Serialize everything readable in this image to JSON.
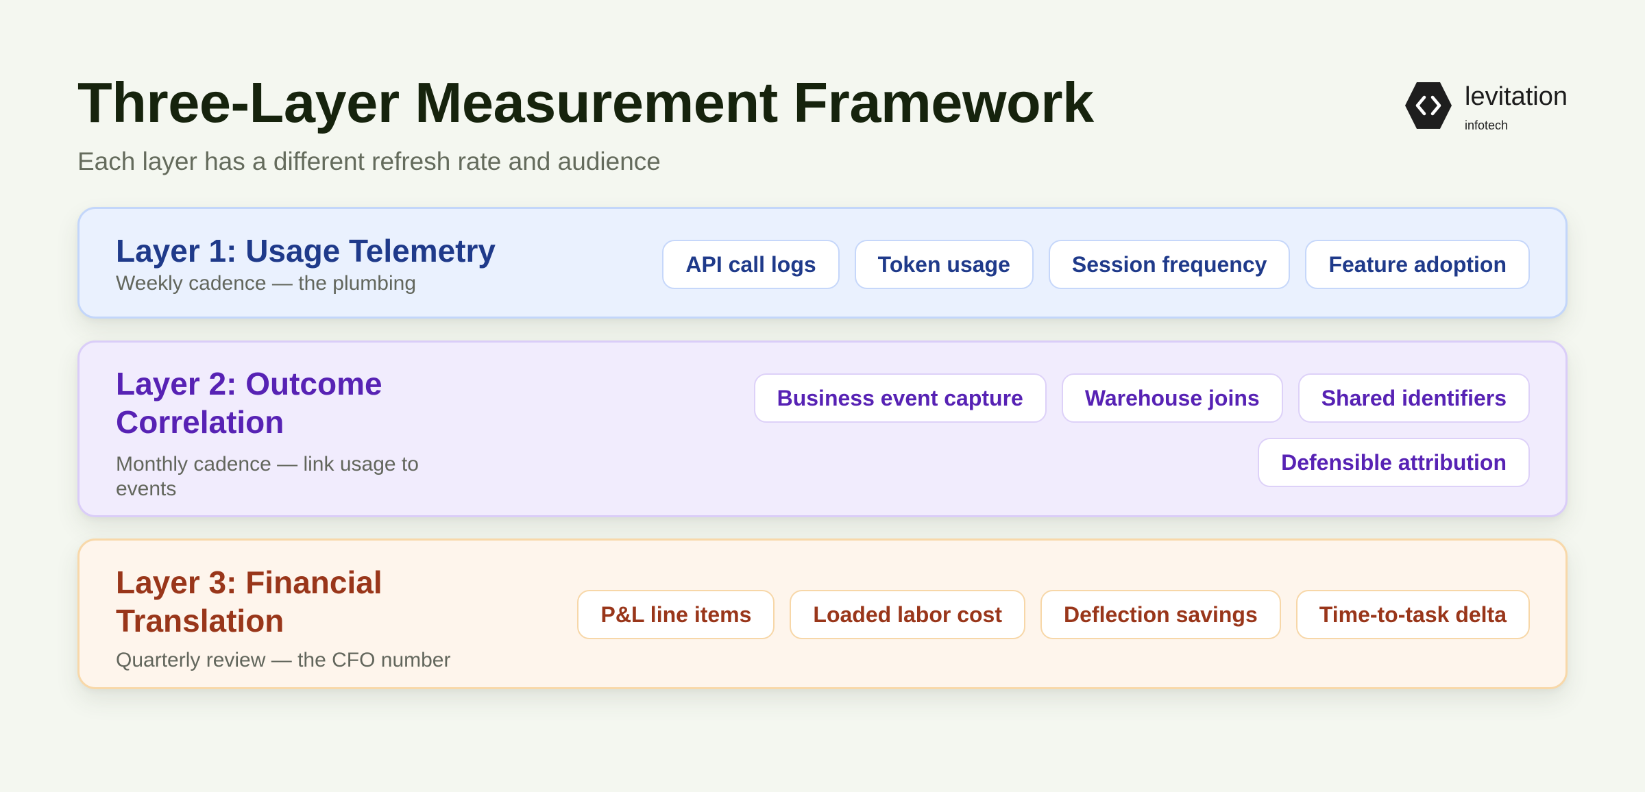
{
  "header": {
    "title": "Three-Layer Measurement Framework",
    "subtitle": "Each layer has a different refresh rate and audience"
  },
  "logo": {
    "icon": "hexagon-code-brackets-icon",
    "name": "levitation",
    "tagline": "infotech"
  },
  "layers": [
    {
      "title": "Layer 1: Usage Telemetry",
      "description": "Weekly cadence — the plumbing",
      "chips": [
        "API call logs",
        "Token usage",
        "Session frequency",
        "Feature adoption"
      ]
    },
    {
      "title": "Layer 2: Outcome Correlation",
      "description": "Monthly cadence — link usage to events",
      "chips": [
        "Business event capture",
        "Warehouse joins",
        "Shared identifiers",
        "Defensible attribution"
      ]
    },
    {
      "title": "Layer 3: Financial Translation",
      "description": "Quarterly review — the CFO number",
      "chips": [
        "P&L line items",
        "Loaded labor cost",
        "Deflection savings",
        "Time-to-task delta"
      ]
    }
  ],
  "colors": {
    "background": "#f4f7f0",
    "title": "#16230d",
    "layer1_accent": "#1f3a8a",
    "layer1_fill": "#eaf1fe",
    "layer2_accent": "#5722b4",
    "layer2_fill": "#f1ecfd",
    "layer3_accent": "#99361a",
    "layer3_fill": "#fef5ec"
  }
}
